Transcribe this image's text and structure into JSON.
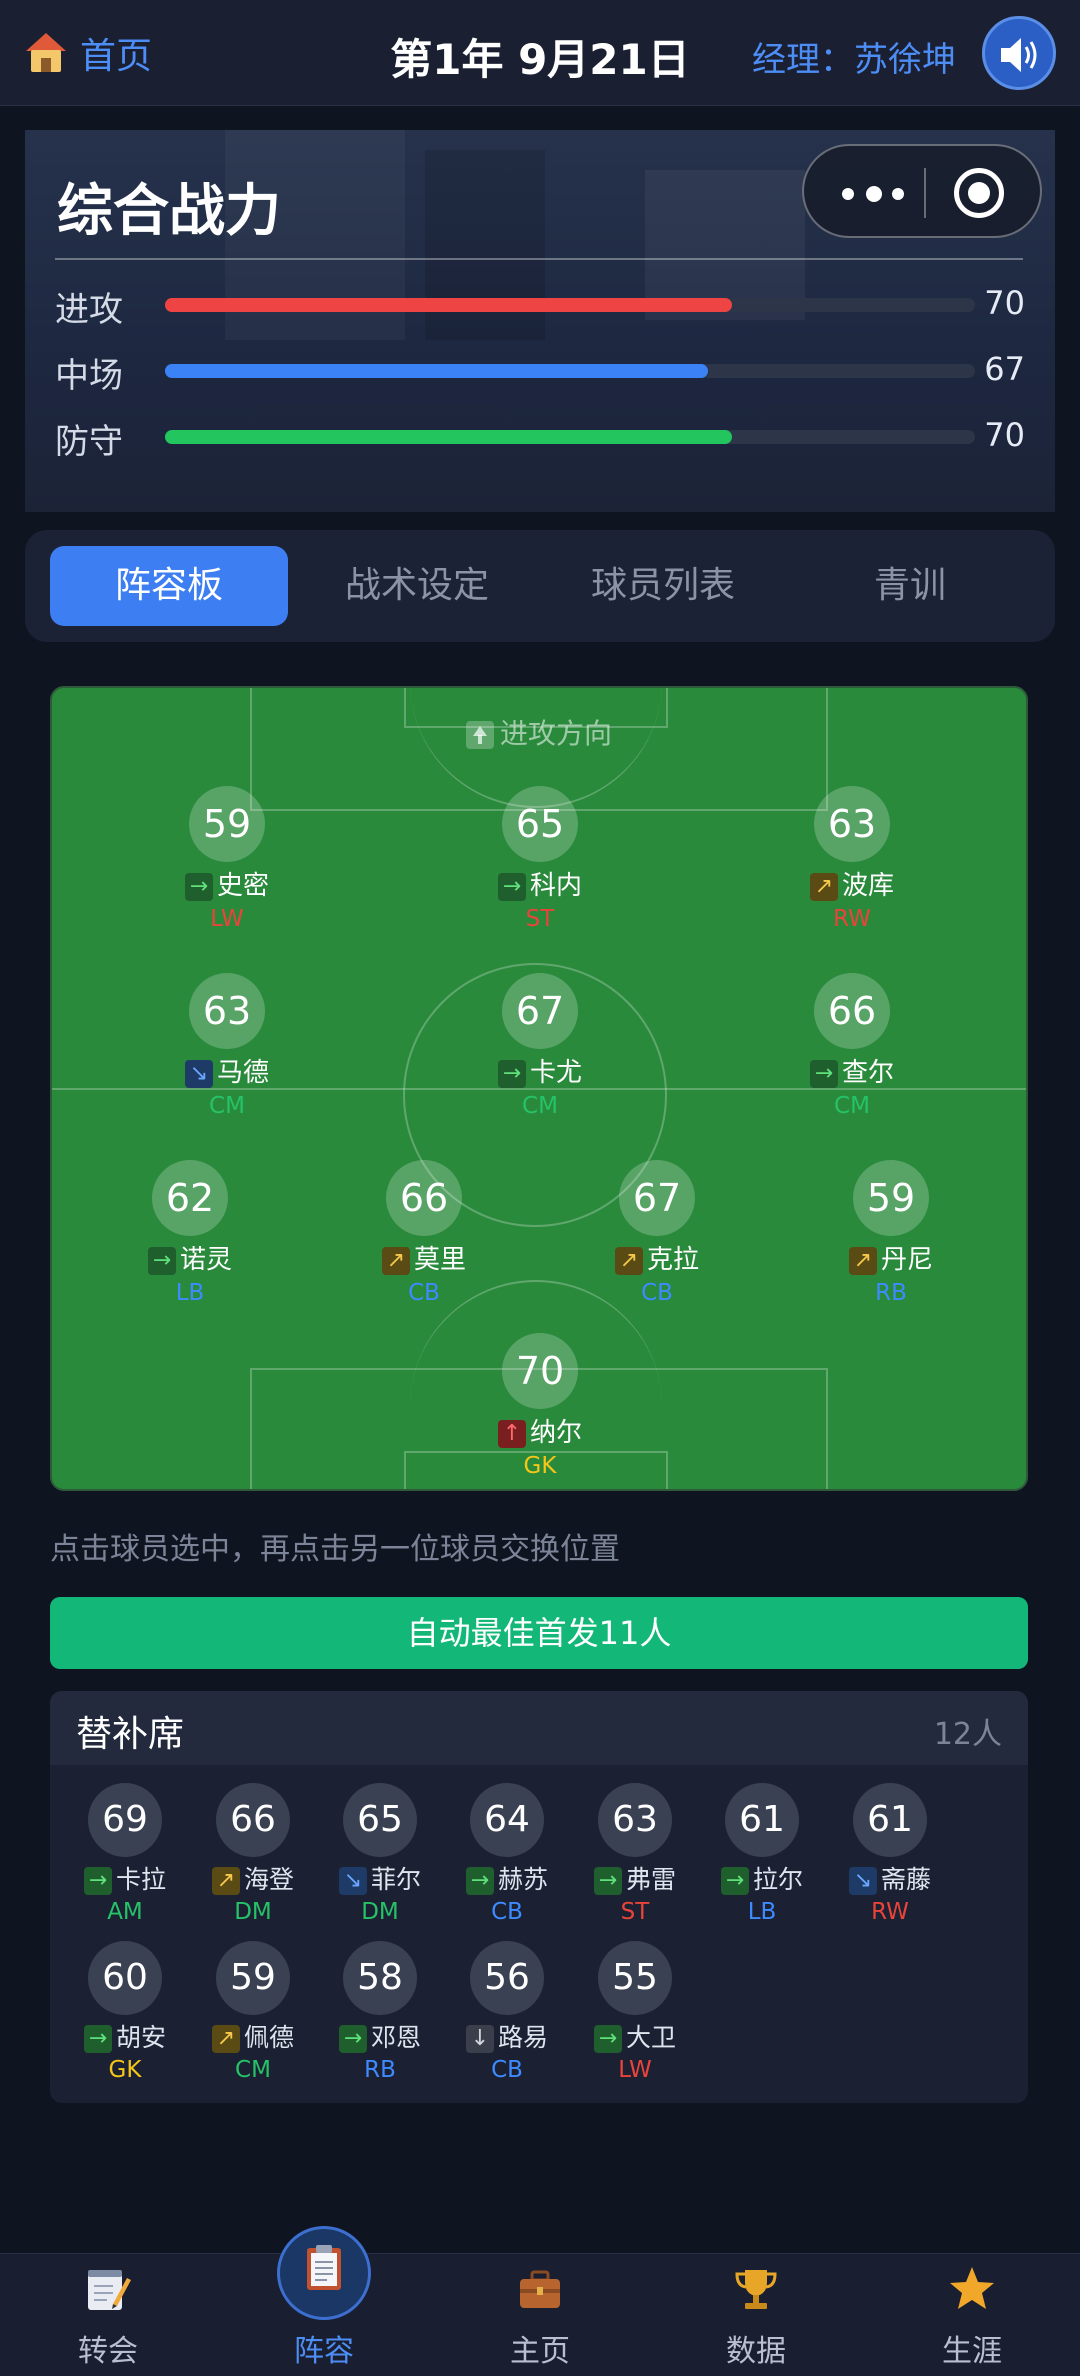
{
  "topbar": {
    "home_label": "首页",
    "date": "第1年 9月21日",
    "manager": "经理：苏徐坤"
  },
  "power": {
    "title": "综合战力",
    "stats": [
      {
        "label": "进攻",
        "value": "70",
        "fill": 0.7,
        "color": "#ef4444"
      },
      {
        "label": "中场",
        "value": "67",
        "fill": 0.67,
        "color": "#3b82f6"
      },
      {
        "label": "防守",
        "value": "70",
        "fill": 0.7,
        "color": "#22c55e"
      }
    ]
  },
  "tabs": [
    "阵容板",
    "战术设定",
    "球员列表",
    "青训"
  ],
  "pitch": {
    "attack_direction": "进攻方向",
    "players": [
      {
        "rating": "59",
        "trend": "→",
        "trend_class": "trend-flat",
        "name": "史密",
        "pos": "LW",
        "pos_class": "pos-FWD"
      },
      {
        "rating": "65",
        "trend": "→",
        "trend_class": "trend-flat",
        "name": "科内",
        "pos": "ST",
        "pos_class": "pos-FWD"
      },
      {
        "rating": "63",
        "trend": "↗",
        "trend_class": "trend-up",
        "name": "波库",
        "pos": "RW",
        "pos_class": "pos-FWD"
      },
      {
        "rating": "63",
        "trend": "↘",
        "trend_class": "trend-down",
        "name": "马德",
        "pos": "CM",
        "pos_class": "pos-MID"
      },
      {
        "rating": "67",
        "trend": "→",
        "trend_class": "trend-flat",
        "name": "卡尤",
        "pos": "CM",
        "pos_class": "pos-MID"
      },
      {
        "rating": "66",
        "trend": "→",
        "trend_class": "trend-flat",
        "name": "查尔",
        "pos": "CM",
        "pos_class": "pos-MID"
      },
      {
        "rating": "62",
        "trend": "→",
        "trend_class": "trend-flat",
        "name": "诺灵",
        "pos": "LB",
        "pos_class": "pos-DEF"
      },
      {
        "rating": "66",
        "trend": "↗",
        "trend_class": "trend-up",
        "name": "莫里",
        "pos": "CB",
        "pos_class": "pos-DEF"
      },
      {
        "rating": "67",
        "trend": "↗",
        "trend_class": "trend-up",
        "name": "克拉",
        "pos": "CB",
        "pos_class": "pos-DEF"
      },
      {
        "rating": "59",
        "trend": "↗",
        "trend_class": "trend-up",
        "name": "丹尼",
        "pos": "RB",
        "pos_class": "pos-DEF"
      },
      {
        "rating": "70",
        "trend": "↑",
        "trend_class": "trend-strong",
        "name": "纳尔",
        "pos": "GK",
        "pos_class": "pos-GK"
      }
    ]
  },
  "hint": "点击球员选中，再点击另一位球员交换位置",
  "auto_button": "自动最佳首发11人",
  "bench": {
    "title": "替补席",
    "count": "12人",
    "players": [
      {
        "rating": "69",
        "trend": "→",
        "trend_class": "trend-flat",
        "name": "卡拉",
        "pos": "AM",
        "pos_class": "pos-MID"
      },
      {
        "rating": "66",
        "trend": "↗",
        "trend_class": "trend-up",
        "name": "海登",
        "pos": "DM",
        "pos_class": "pos-MID"
      },
      {
        "rating": "65",
        "trend": "↘",
        "trend_class": "trend-down",
        "name": "菲尔",
        "pos": "DM",
        "pos_class": "pos-MID"
      },
      {
        "rating": "64",
        "trend": "→",
        "trend_class": "trend-flat",
        "name": "赫苏",
        "pos": "CB",
        "pos_class": "pos-DEF"
      },
      {
        "rating": "63",
        "trend": "→",
        "trend_class": "trend-flat",
        "name": "弗雷",
        "pos": "ST",
        "pos_class": "pos-FWD"
      },
      {
        "rating": "61",
        "trend": "→",
        "trend_class": "trend-flat",
        "name": "拉尔",
        "pos": "LB",
        "pos_class": "pos-DEF"
      },
      {
        "rating": "61",
        "trend": "↘",
        "trend_class": "trend-down",
        "name": "斋藤",
        "pos": "RW",
        "pos_class": "pos-FWD"
      },
      {
        "rating": "60",
        "trend": "→",
        "trend_class": "trend-flat",
        "name": "胡安",
        "pos": "GK",
        "pos_class": "pos-GK"
      },
      {
        "rating": "59",
        "trend": "↗",
        "trend_class": "trend-up",
        "name": "佩德",
        "pos": "CM",
        "pos_class": "pos-MID"
      },
      {
        "rating": "58",
        "trend": "→",
        "trend_class": "trend-flat",
        "name": "邓恩",
        "pos": "RB",
        "pos_class": "pos-DEF"
      },
      {
        "rating": "56",
        "trend": "↓",
        "trend_class": "trend-drop",
        "name": "路易",
        "pos": "CB",
        "pos_class": "pos-DEF"
      },
      {
        "rating": "55",
        "trend": "→",
        "trend_class": "trend-flat",
        "name": "大卫",
        "pos": "LW",
        "pos_class": "pos-FWD"
      }
    ]
  },
  "nav": [
    {
      "label": "转会",
      "icon": "notepad-pencil-icon"
    },
    {
      "label": "阵容",
      "icon": "clipboard-icon"
    },
    {
      "label": "主页",
      "icon": "briefcase-icon"
    },
    {
      "label": "数据",
      "icon": "trophy-icon"
    },
    {
      "label": "生涯",
      "icon": "star-icon"
    }
  ],
  "colors": {
    "accent_blue": "#3d7ff2",
    "auto_button_green": "#13b879",
    "pitch_green": "#2a8a3c"
  }
}
